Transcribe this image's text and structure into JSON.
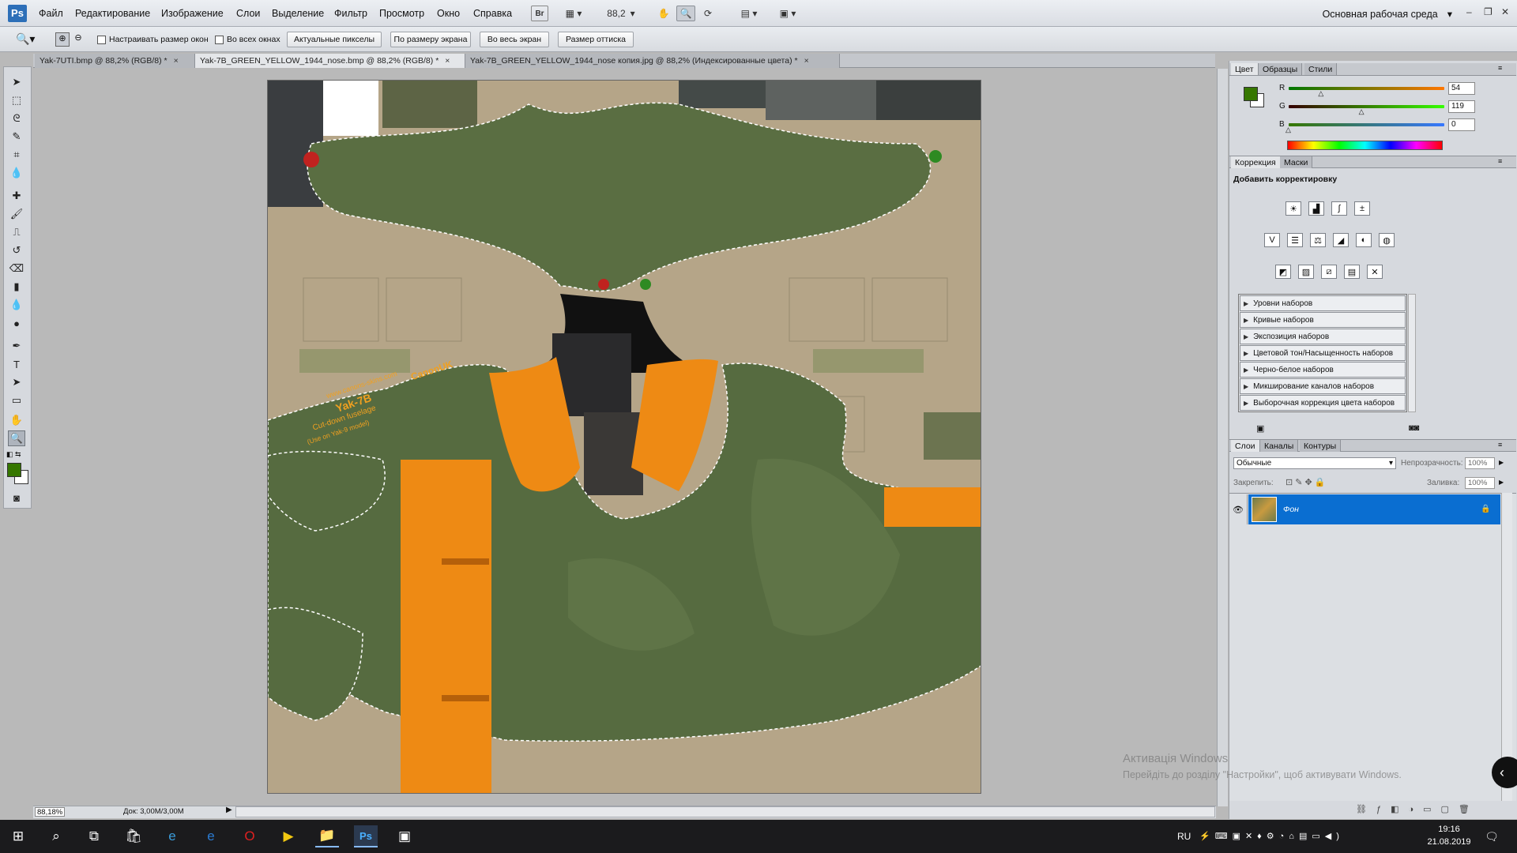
{
  "app": {
    "logo": "Ps"
  },
  "menu": [
    "Файл",
    "Редактирование",
    "Изображение",
    "Слои",
    "Выделение",
    "Фильтр",
    "Просмотр",
    "Окно",
    "Справка"
  ],
  "menubar": {
    "zoom_value": "88,2",
    "workspace": "Основная рабочая среда",
    "bridge_label": "Br"
  },
  "options": {
    "resize_windows": "Настраивать размер окон",
    "all_windows": "Во всех окнах",
    "actual_pixels": "Актуальные пикселы",
    "fit_screen": "По размеру экрана",
    "fill_screen": "Во весь экран",
    "print_size": "Размер оттиска"
  },
  "tabs": [
    {
      "label": "Yak-7UTI.bmp @ 88,2% (RGB/8) *",
      "active": false
    },
    {
      "label": "Yak-7B_GREEN_YELLOW_1944_nose.bmp @ 88,2% (RGB/8) *",
      "active": true
    },
    {
      "label": "Yak-7B_GREEN_YELLOW_1944_nose копия.jpg @ 88,2% (Индексированные цвета) *",
      "active": false
    }
  ],
  "canvas_text": {
    "site": "www.canons-skins.com",
    "author": "CanonUK",
    "title": "Yak-7B",
    "subtitle": "Cut-down fuselage",
    "note": "(Use on Yak-9 model)"
  },
  "status": {
    "zoom": "88,18%",
    "doc": "Док: 3,00M/3,00M"
  },
  "color_panel": {
    "tabs": [
      "Цвет",
      "Образцы",
      "Стили"
    ],
    "r_label": "R",
    "g_label": "G",
    "b_label": "B",
    "r": "54",
    "g": "119",
    "b": "0",
    "r_frac": 0.21,
    "g_frac": 0.47,
    "b_frac": 0.0,
    "foreground": "#367700"
  },
  "adjustments": {
    "tabs": [
      "Коррекция",
      "Маски"
    ],
    "heading": "Добавить корректировку",
    "presets": [
      "Уровни наборов",
      "Кривые наборов",
      "Экспозиция наборов",
      "Цветовой тон/Насыщенность наборов",
      "Черно-белое наборов",
      "Микширование каналов наборов",
      "Выборочная коррекция цвета наборов"
    ]
  },
  "layers": {
    "tabs": [
      "Слои",
      "Каналы",
      "Контуры"
    ],
    "blend_mode": "Обычные",
    "opacity_label": "Непрозрачность:",
    "opacity": "100%",
    "lock_label": "Закрепить:",
    "fill_label": "Заливка:",
    "fill": "100%",
    "layer_name": "Фон"
  },
  "watermark": {
    "line1": "Активація Windows",
    "line2": "Перейдіть до розділу \"Настройки\", щоб активувати Windows."
  },
  "taskbar": {
    "lang": "RU",
    "time": "19:16",
    "date": "21.08.2019"
  }
}
